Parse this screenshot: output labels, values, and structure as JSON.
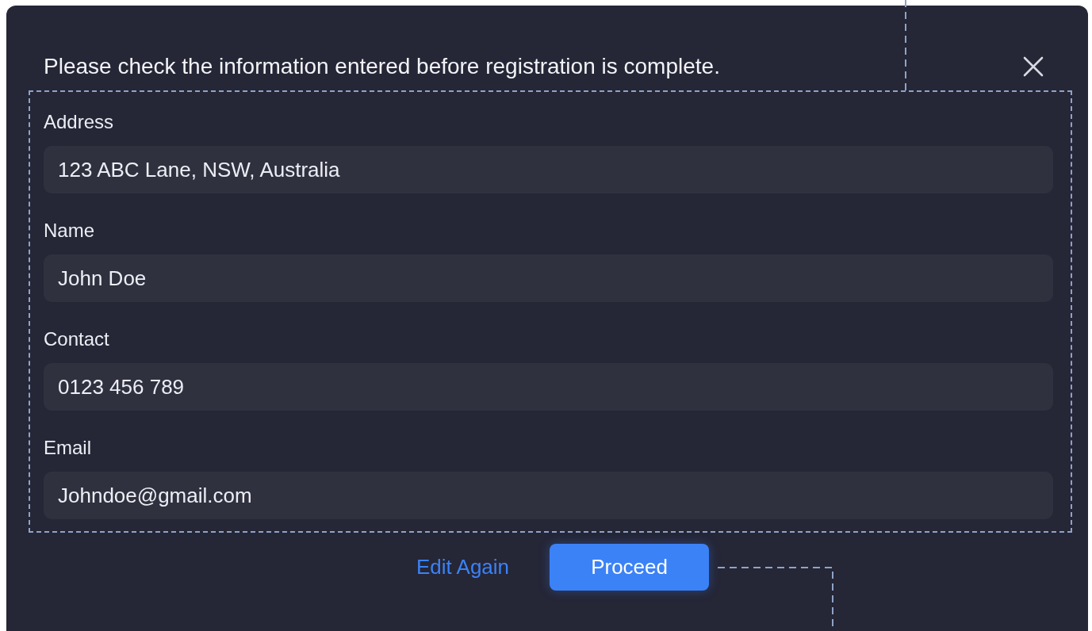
{
  "dialog": {
    "title": "Please check the information entered before registration is complete.",
    "fields": [
      {
        "label": "Address",
        "value": "123 ABC Lane, NSW, Australia"
      },
      {
        "label": "Name",
        "value": "John Doe"
      },
      {
        "label": "Contact",
        "value": "0123 456 789"
      },
      {
        "label": "Email",
        "value": "Johndoe@gmail.com"
      }
    ],
    "buttons": [
      {
        "kind": "link",
        "label": "Edit Again"
      },
      {
        "kind": "primary",
        "label": "Proceed"
      }
    ]
  }
}
